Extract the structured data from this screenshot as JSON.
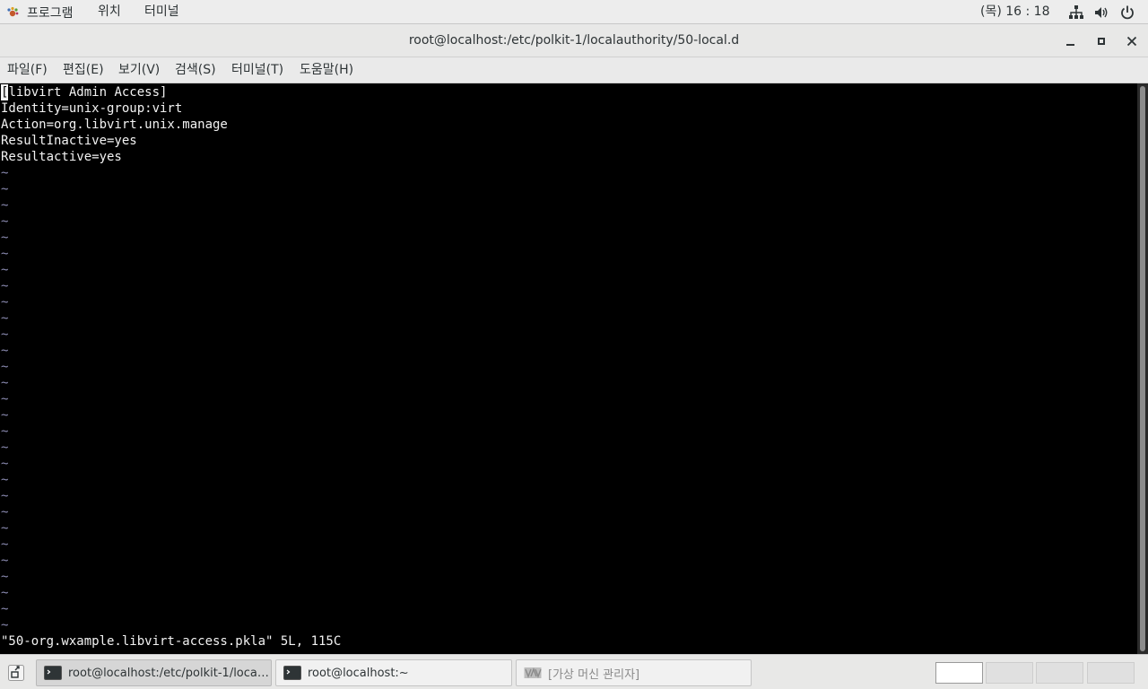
{
  "topbar": {
    "applications": "프로그램",
    "places": "위치",
    "terminal": "터미널",
    "clock": "(목) 16 : 18",
    "icons": [
      "network-icon",
      "volume-icon",
      "power-icon"
    ]
  },
  "window": {
    "title": "root@localhost:/etc/polkit-1/localauthority/50-local.d"
  },
  "menubar": {
    "items": [
      "파일(F)",
      "편집(E)",
      "보기(V)",
      "검색(S)",
      "터미널(T)",
      "도움말(H)"
    ]
  },
  "terminal": {
    "cursor_char": "[",
    "lines": [
      "libvirt Admin Access]",
      "Identity=unix-group:virt",
      "Action=org.libvirt.unix.manage",
      "ResultInactive=yes",
      "Resultactive=yes"
    ],
    "tilde": "~",
    "tilde_count": 29,
    "status_line": "\"50-org.wxample.libvirt-access.pkla\" 5L, 115C"
  },
  "taskbar": {
    "tasks": [
      {
        "label": "root@localhost:/etc/polkit-1/locala…",
        "active": true
      },
      {
        "label": "root@localhost:~",
        "active": false
      },
      {
        "label": "[가상 머신 관리자]",
        "active": false
      }
    ],
    "workspaces": 4,
    "current_workspace": 1
  },
  "colors": {
    "terminal_bg": "#000000",
    "terminal_fg": "#f2f2f2",
    "tilde": "#8a8ab0",
    "panel_bg": "#ededed"
  }
}
